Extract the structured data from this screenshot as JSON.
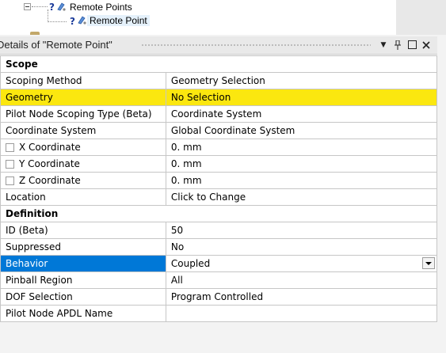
{
  "tree": {
    "parent_label": "Remote Points",
    "child_label": "Remote Point",
    "state_glyph": "?"
  },
  "panel": {
    "title": "Details of \"Remote Point\"",
    "buttons": {
      "dropdown_glyph": "▼",
      "pin_glyph": "₽",
      "maximize_glyph": "☐",
      "close_glyph": "✕"
    }
  },
  "details": {
    "scope_header": "Scope",
    "scoping_method": {
      "label": "Scoping Method",
      "value": "Geometry Selection"
    },
    "geometry": {
      "label": "Geometry",
      "value": "No Selection"
    },
    "pilot_node_scoping_type": {
      "label": "Pilot Node Scoping Type (Beta)",
      "value": "Coordinate System"
    },
    "coordinate_system": {
      "label": "Coordinate System",
      "value": "Global Coordinate System"
    },
    "x_coordinate": {
      "label": "X Coordinate",
      "value": "0. mm",
      "checked": false
    },
    "y_coordinate": {
      "label": "Y Coordinate",
      "value": "0. mm",
      "checked": false
    },
    "z_coordinate": {
      "label": "Z Coordinate",
      "value": "0. mm",
      "checked": false
    },
    "location": {
      "label": "Location",
      "value": "Click to Change"
    },
    "definition_header": "Definition",
    "id": {
      "label": "ID (Beta)",
      "value": "50"
    },
    "suppressed": {
      "label": "Suppressed",
      "value": "No"
    },
    "behavior": {
      "label": "Behavior",
      "value": "Coupled"
    },
    "pinball_region": {
      "label": "Pinball Region",
      "value": "All"
    },
    "dof_selection": {
      "label": "DOF Selection",
      "value": "Program Controlled"
    },
    "pilot_node_apdl_name": {
      "label": "Pilot Node APDL Name",
      "value": ""
    }
  },
  "colors": {
    "highlight_yellow": "#fbe70f",
    "selection_blue": "#0078d7"
  },
  "icons": [
    "collapse-icon",
    "remote-point-icon"
  ]
}
